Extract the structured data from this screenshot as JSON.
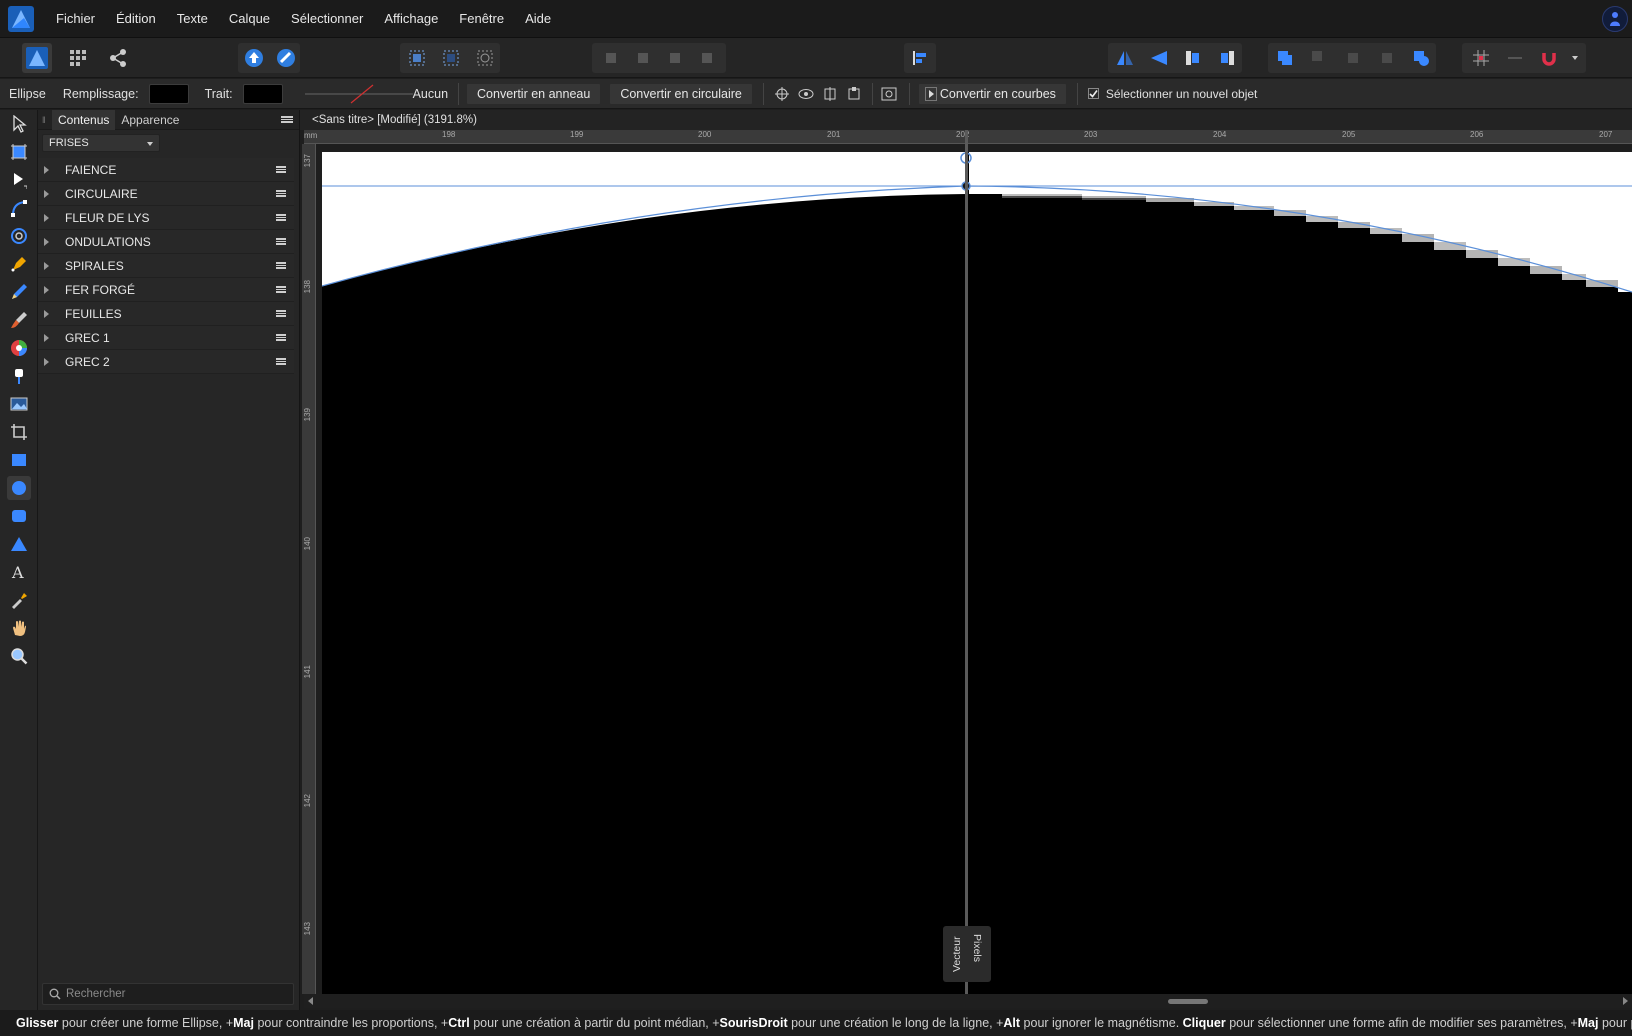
{
  "menu": [
    "Fichier",
    "Édition",
    "Texte",
    "Calque",
    "Sélectionner",
    "Affichage",
    "Fenêtre",
    "Aide"
  ],
  "context_bar": {
    "tool_name": "Ellipse",
    "fill_label": "Remplissage:",
    "stroke_label": "Trait:",
    "stroke_style": "Aucun",
    "convert_ring": "Convertir en anneau",
    "convert_circular": "Convertir en circulaire",
    "convert_curves": "Convertir en courbes",
    "select_new_object": "Sélectionner un nouvel objet",
    "select_new_object_checked": true
  },
  "panel": {
    "tabs": [
      "Contenus",
      "Apparence"
    ],
    "active_tab": "Contenus",
    "category": "FRISES",
    "groups": [
      "FAIENCE",
      "CIRCULAIRE",
      "FLEUR DE LYS",
      "ONDULATIONS",
      "SPIRALES",
      "FER FORGÉ",
      "FEUILLES",
      "GREC 1",
      "GREC 2"
    ],
    "search_placeholder": "Rechercher"
  },
  "document": {
    "title": "<Sans titre> [Modifié] (3191.8%)",
    "ruler_unit": "mm",
    "h_ruler_ticks": [
      "198",
      "199",
      "200",
      "201",
      "202",
      "203",
      "204",
      "205",
      "206",
      "207"
    ],
    "v_ruler_ticks": [
      "137",
      "138",
      "139",
      "140",
      "141",
      "142",
      "143"
    ],
    "split_left_label": "Vecteur",
    "split_right_label": "Pixels"
  },
  "statusbar": {
    "parts": [
      {
        "b": "Glisser",
        "t": " pour créer une forme Ellipse, +"
      },
      {
        "b": "Maj",
        "t": " pour contraindre les proportions, +"
      },
      {
        "b": "Ctrl",
        "t": " pour une création à partir du point médian, +"
      },
      {
        "b": "SourisDroit",
        "t": " pour une création le long de la ligne, +"
      },
      {
        "b": "Alt",
        "t": " pour ignorer le magnétisme. "
      },
      {
        "b": "Cliquer",
        "t": " pour sélectionner une forme afin de modifier ses paramètres, +"
      },
      {
        "b": "Maj",
        "t": " pour permuter la"
      }
    ]
  },
  "colors": {
    "accent": "#1e6fd6",
    "selection_outline": "#5b8fd8",
    "magnet": "#e0304a"
  }
}
